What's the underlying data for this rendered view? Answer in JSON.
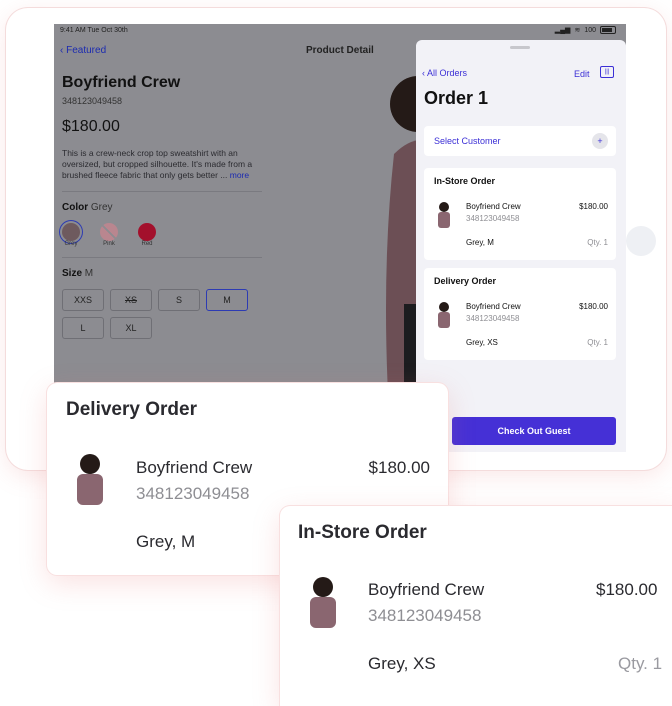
{
  "status": {
    "time": "9:41 AM  Tue Oct 30th",
    "battery": "100"
  },
  "nav": {
    "back": "Featured",
    "title": "Product Detail"
  },
  "product": {
    "name": "Boyfriend Crew",
    "sku": "348123049458",
    "price": "$180.00",
    "description": "This is a crew-neck crop top sweatshirt with an oversized, but cropped silhouette.  It's made from a brushed fleece fabric that only gets better ...",
    "more": "more",
    "color_label": "Color",
    "color_value": "Grey",
    "colors": [
      {
        "name": "Grey",
        "hex": "#6e5a5e"
      },
      {
        "name": "Pink",
        "hex": "#b9868f"
      },
      {
        "name": "Red",
        "hex": "#a3102c"
      }
    ],
    "size_label": "Size",
    "size_value": "M",
    "sizes": [
      "XXS",
      "XS",
      "S",
      "M",
      "L",
      "XL"
    ]
  },
  "sheet": {
    "back": "All Orders",
    "edit": "Edit",
    "title": "Order 1",
    "select_customer": "Select Customer",
    "instore": {
      "header": "In-Store Order",
      "name": "Boyfriend Crew",
      "sku": "348123049458",
      "price": "$180.00",
      "variant": "Grey, M",
      "qty": "Qty. 1"
    },
    "delivery": {
      "header": "Delivery Order",
      "name": "Boyfriend Crew",
      "sku": "348123049458",
      "price": "$180.00",
      "variant": "Grey, XS",
      "qty": "Qty. 1"
    },
    "checkout": "Check Out Guest"
  },
  "callout_delivery": {
    "header": "Delivery Order",
    "name": "Boyfriend Crew",
    "sku": "348123049458",
    "price": "$180.00",
    "variant": "Grey, M"
  },
  "callout_instore": {
    "header": "In-Store Order",
    "name": "Boyfriend Crew",
    "sku": "348123049458",
    "price": "$180.00",
    "variant": "Grey, XS",
    "qty": "Qty. 1"
  },
  "colors": {
    "accent": "#4530d6",
    "link": "#3b2fd6",
    "sweater": "#8a6670"
  }
}
